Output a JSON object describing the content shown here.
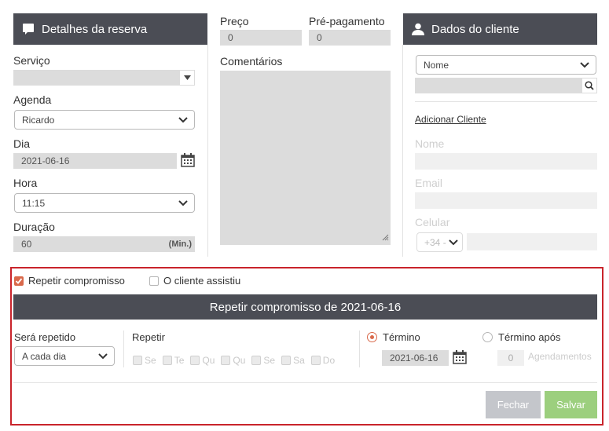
{
  "booking": {
    "header": "Detalhes da reserva",
    "service_label": "Serviço",
    "service_value": "",
    "agenda_label": "Agenda",
    "agenda_value": "Ricardo",
    "day_label": "Dia",
    "day_value": "2021-06-16",
    "time_label": "Hora",
    "time_value": "11:15",
    "duration_label": "Duração",
    "duration_value": "60",
    "duration_unit": "(Min.)"
  },
  "pricing": {
    "price_label": "Preço",
    "price_value": "0",
    "prepay_label": "Pré-pagamento",
    "prepay_value": "0",
    "comments_label": "Comentários",
    "comments_value": ""
  },
  "client": {
    "header": "Dados do cliente",
    "select_value": "Nome",
    "search_value": "",
    "add_client_link": "Adicionar Cliente",
    "name_label": "Nome",
    "email_label": "Email",
    "phone_label": "Celular",
    "phone_prefix": "+34 -"
  },
  "repeat": {
    "repeat_checkbox_label": "Repetir compromisso",
    "attended_checkbox_label": "O cliente assistiu",
    "banner": "Repetir compromisso de 2021-06-16",
    "will_repeat_label": "Será repetido",
    "will_repeat_value": "A cada dia",
    "repeat_label": "Repetir",
    "days": [
      "Se",
      "Te",
      "Qu",
      "Qu",
      "Se",
      "Sa",
      "Do"
    ],
    "end_label": "Término",
    "end_date": "2021-06-16",
    "end_after_label": "Término após",
    "end_after_value": "0",
    "end_after_unit": "Agendamentos"
  },
  "actions": {
    "close_label": "Fechar",
    "save_label": "Salvar"
  },
  "colors": {
    "header_bg": "#4b4d55",
    "accent": "#d9694b",
    "frame_border": "#c9242b",
    "save_button": "#9ccf7e",
    "close_button": "#c4c6cb"
  }
}
